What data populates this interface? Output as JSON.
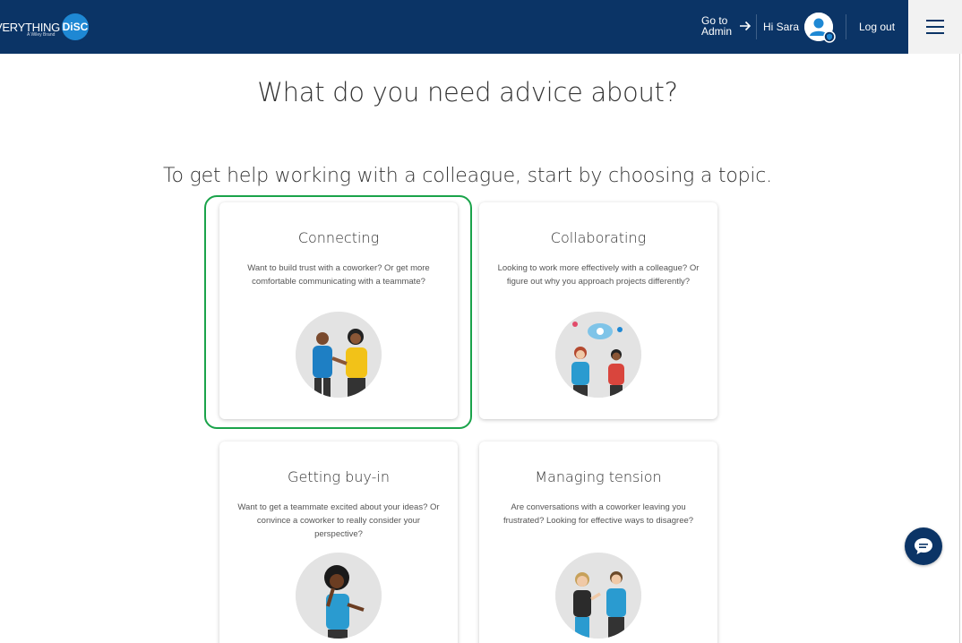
{
  "header": {
    "brand_text": "VERYTHING",
    "brand_badge": "DiSC",
    "brand_sub": "A Wiley Brand",
    "goto_line1": "Go to",
    "goto_line2": "Admin",
    "greeting": "Hi Sara",
    "logout_label": "Log out",
    "menu_icon": "hamburger-icon"
  },
  "main": {
    "title": "What do you need advice about?",
    "subtitle": "To get help working with a colleague, start by choosing a topic.",
    "cards": [
      {
        "title": "Connecting",
        "description": "Want to build trust with a coworker? Or get more comfortable communicating with a teammate?",
        "selected": true
      },
      {
        "title": "Collaborating",
        "description": "Looking to work more effectively with a colleague? Or figure out why you approach projects differently?"
      },
      {
        "title": "Getting buy-in",
        "description": "Want to get a teammate excited about your ideas? Or convince a coworker to really consider your perspective?"
      },
      {
        "title": "Managing tension",
        "description": "Are conversations with a coworker leaving you frustrated? Looking for effective ways to disagree?"
      }
    ]
  },
  "colors": {
    "header_bg": "#0b3466",
    "selected_border": "#1aa34a",
    "accent_blue": "#1e88d4"
  },
  "chat_icon": "chat-bubble-icon"
}
